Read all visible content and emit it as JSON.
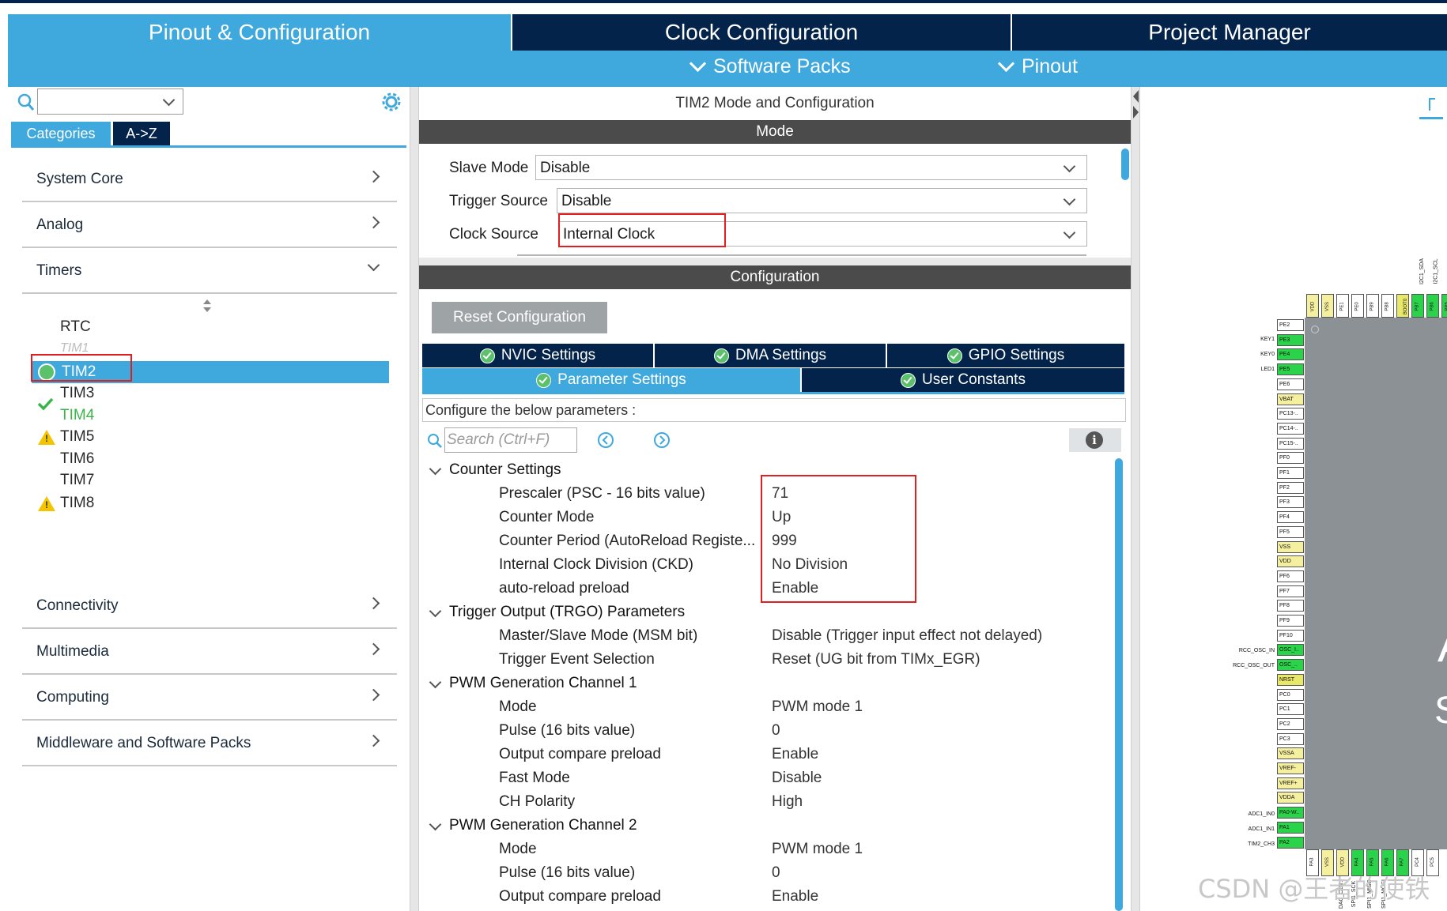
{
  "top_tabs": {
    "pinout": "Pinout & Configuration",
    "clock": "Clock Configuration",
    "project": "Project Manager"
  },
  "sub_menu": {
    "software_packs": "Software Packs",
    "pinout": "Pinout"
  },
  "left": {
    "tab_categories": "Categories",
    "tab_az": "A->Z",
    "categories": {
      "system_core": "System Core",
      "analog": "Analog",
      "timers": "Timers",
      "connectivity": "Connectivity",
      "multimedia": "Multimedia",
      "computing": "Computing",
      "middleware": "Middleware and Software Packs"
    },
    "timers": {
      "rtc": "RTC",
      "tim1": "TIM1",
      "tim2": "TIM2",
      "tim3": "TIM3",
      "tim4": "TIM4",
      "tim5": "TIM5",
      "tim6": "TIM6",
      "tim7": "TIM7",
      "tim8": "TIM8"
    }
  },
  "center": {
    "title": "TIM2 Mode and Configuration",
    "mode_header": "Mode",
    "slave_mode_label": "Slave Mode",
    "slave_mode_value": "Disable",
    "trigger_source_label": "Trigger Source",
    "trigger_source_value": "Disable",
    "clock_source_label": "Clock Source",
    "clock_source_value": "Internal Clock",
    "config_header": "Configuration",
    "reset_button": "Reset Configuration",
    "tabs": {
      "nvic": "NVIC Settings",
      "dma": "DMA Settings",
      "gpio": "GPIO Settings",
      "param": "Parameter Settings",
      "user": "User Constants"
    },
    "configure_text": "Configure the below parameters :",
    "search_placeholder": "Search (Ctrl+F)",
    "sections": {
      "counter": "Counter Settings",
      "trgo": "Trigger Output (TRGO) Parameters",
      "pwm1": "PWM Generation Channel 1",
      "pwm2": "PWM Generation Channel 2"
    },
    "counter_params": [
      {
        "name": "Prescaler (PSC - 16 bits value)",
        "value": "71"
      },
      {
        "name": "Counter Mode",
        "value": "Up"
      },
      {
        "name": "Counter Period (AutoReload Registe...",
        "value": "999"
      },
      {
        "name": "Internal Clock Division (CKD)",
        "value": "No Division"
      },
      {
        "name": "auto-reload preload",
        "value": "Enable"
      }
    ],
    "trgo_params": [
      {
        "name": "Master/Slave Mode (MSM bit)",
        "value": "Disable (Trigger input effect not delayed)"
      },
      {
        "name": "Trigger Event Selection",
        "value": "Reset (UG bit from TIMx_EGR)"
      }
    ],
    "pwm1_params": [
      {
        "name": "Mode",
        "value": "PWM mode 1"
      },
      {
        "name": "Pulse (16 bits value)",
        "value": "0"
      },
      {
        "name": "Output compare preload",
        "value": "Enable"
      },
      {
        "name": "Fast Mode",
        "value": "Disable"
      },
      {
        "name": "CH Polarity",
        "value": "High"
      }
    ],
    "pwm2_params": [
      {
        "name": "Mode",
        "value": "PWM mode 1"
      },
      {
        "name": "Pulse (16 bits value)",
        "value": "0"
      },
      {
        "name": "Output compare preload",
        "value": "Enable"
      }
    ]
  },
  "chip": {
    "left_pins": [
      "PE2",
      "PE3",
      "PE4",
      "PE5",
      "PE6",
      "VBAT",
      "PC13-..",
      "PC14-..",
      "PC15-..",
      "PF0",
      "PF1",
      "PF2",
      "PF3",
      "PF4",
      "PF5",
      "VSS",
      "VDD",
      "PF6",
      "PF7",
      "PF8",
      "PF9",
      "PF10",
      "OSC_I..",
      "OSC_..",
      "NRST",
      "PC0",
      "PC1",
      "PC2",
      "PC3",
      "VSSA",
      "VREF-",
      "VREF+",
      "VDDA",
      "PA0-W..",
      "PA1",
      "PA2"
    ],
    "signal_labels": {
      "key1": "KEY1",
      "key0": "KEY0",
      "led1": "LED1",
      "osc_in": "RCC_OSC_IN",
      "osc_out": "RCC_OSC_OUT",
      "adc_in0": "ADC1_IN0",
      "adc_in1": "ADC1_IN1",
      "tim2_ch3": "TIM2_CH3"
    },
    "top_pins": [
      "VDD",
      "VSS",
      "PE1",
      "PE0",
      "PB9",
      "PB8",
      "BOOT0",
      "PB7",
      "PB6",
      "PB5"
    ],
    "top_signals": [
      "I2C1_SDA",
      "I2C1_SCL"
    ],
    "bottom_pins": [
      "PA3",
      "VSS",
      "VDD",
      "PA4",
      "PA5",
      "PA6",
      "PA7",
      "PC4",
      "PC5"
    ],
    "bottom_signals": [
      "DAC_OUT1",
      "SPI1_SCK",
      "SPI1_MISO",
      "SPI1_MOSI"
    ],
    "chip_letter_1": "A",
    "chip_letter_2": "S"
  },
  "watermark": "CSDN @王者的使铁",
  "colors": {
    "active_tab": "#3fa9dd",
    "dark_tab": "#03234b",
    "selected_row": "#3fa9dd",
    "red_highlight": "#e02020",
    "green_pin": "#2bd34a",
    "yellow_pin": "#f5f0a0"
  }
}
